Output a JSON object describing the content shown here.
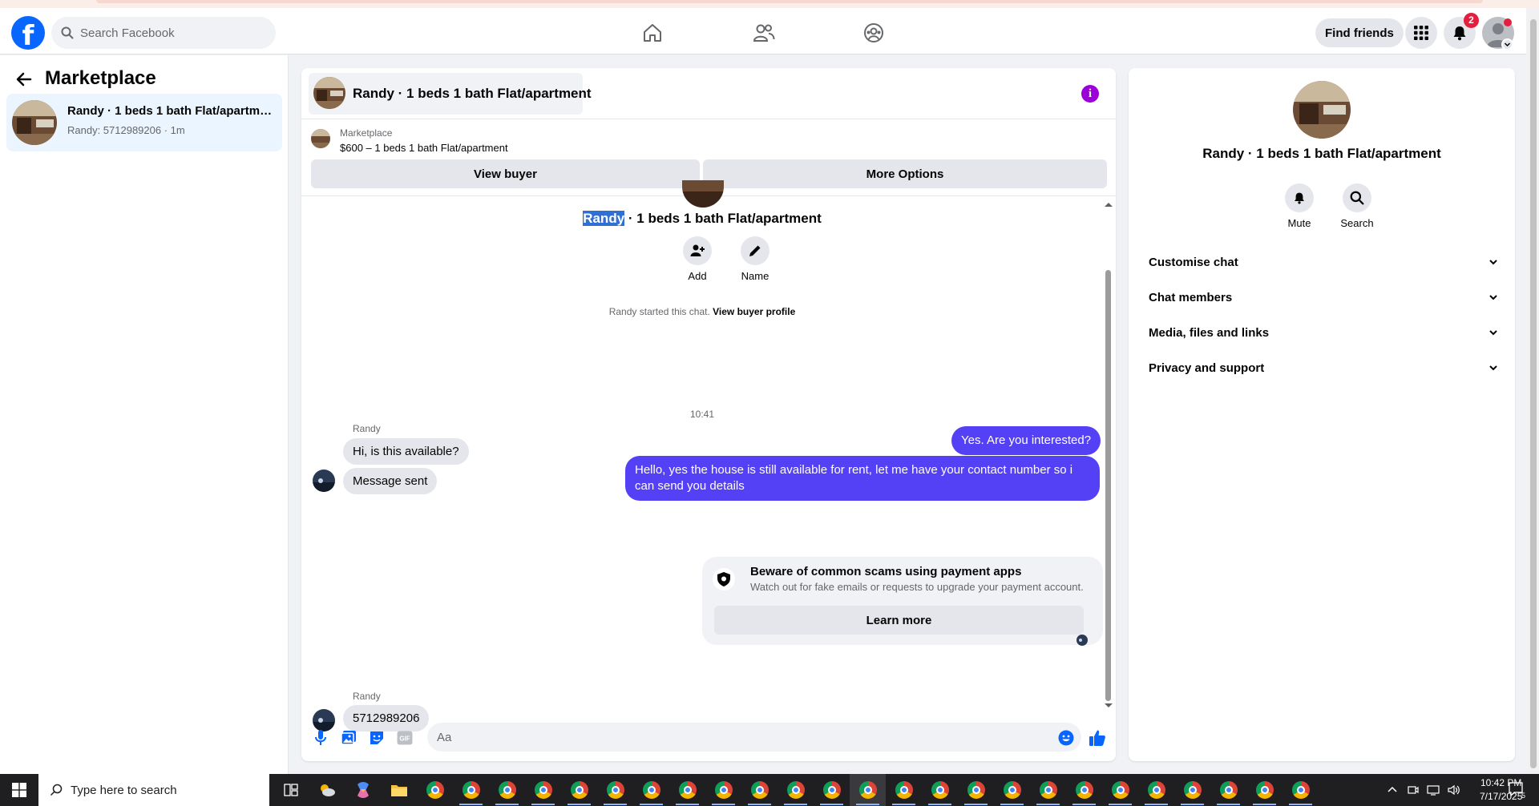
{
  "header": {
    "search_placeholder": "Search Facebook",
    "find_friends_label": "Find friends",
    "notification_count": "2"
  },
  "sidebar": {
    "title": "Marketplace",
    "items": [
      {
        "name": "Randy · 1 beds 1 bath Flat/apartme...",
        "subtitle": "Randy: 5712989206 · 1m"
      }
    ]
  },
  "chat": {
    "title": "Randy · 1 beds 1 bath Flat/apartment",
    "marketplace_label": "Marketplace",
    "listing": "$600 – 1 beds 1 bath Flat/apartment",
    "view_buyer_label": "View buyer",
    "more_options_label": "More Options",
    "intro": {
      "name_highlight": "Randy",
      "name_rest": " · 1 beds 1 bath Flat/apartment",
      "add_label": "Add",
      "name_label": "Name"
    },
    "started_text": "Randy started this chat. ",
    "view_buyer_profile": "View buyer profile",
    "messages": {
      "sender_1": "Randy",
      "in_1": "Hi, is this available?",
      "in_2": "Message sent",
      "timestamp": "10:41",
      "out_1": "Yes. Are you interested?",
      "out_2": "Hello, yes the house is still available for rent, let me have your contact number so i can send you details",
      "sender_2": "Randy",
      "in_3": "5712989206"
    },
    "scam_card": {
      "title": "Beware of common scams using payment apps",
      "subtitle": "Watch out for fake emails or requests to upgrade your payment account.",
      "button": "Learn more"
    },
    "composer_placeholder": "Aa"
  },
  "right_panel": {
    "title": "Randy · 1 beds 1 bath Flat/apartment",
    "mute_label": "Mute",
    "search_label": "Search",
    "sections": [
      "Customise chat",
      "Chat members",
      "Media, files and links",
      "Privacy and support"
    ]
  },
  "taskbar": {
    "search_placeholder": "Type here to search",
    "time": "10:42 PM",
    "date": "7/17/2025",
    "notification_count": "5"
  },
  "colors": {
    "brand": "#0866ff",
    "outgoing_bubble": "#5440f5",
    "info_icon": "#9b00d9",
    "notification_badge": "#e41e3f"
  }
}
